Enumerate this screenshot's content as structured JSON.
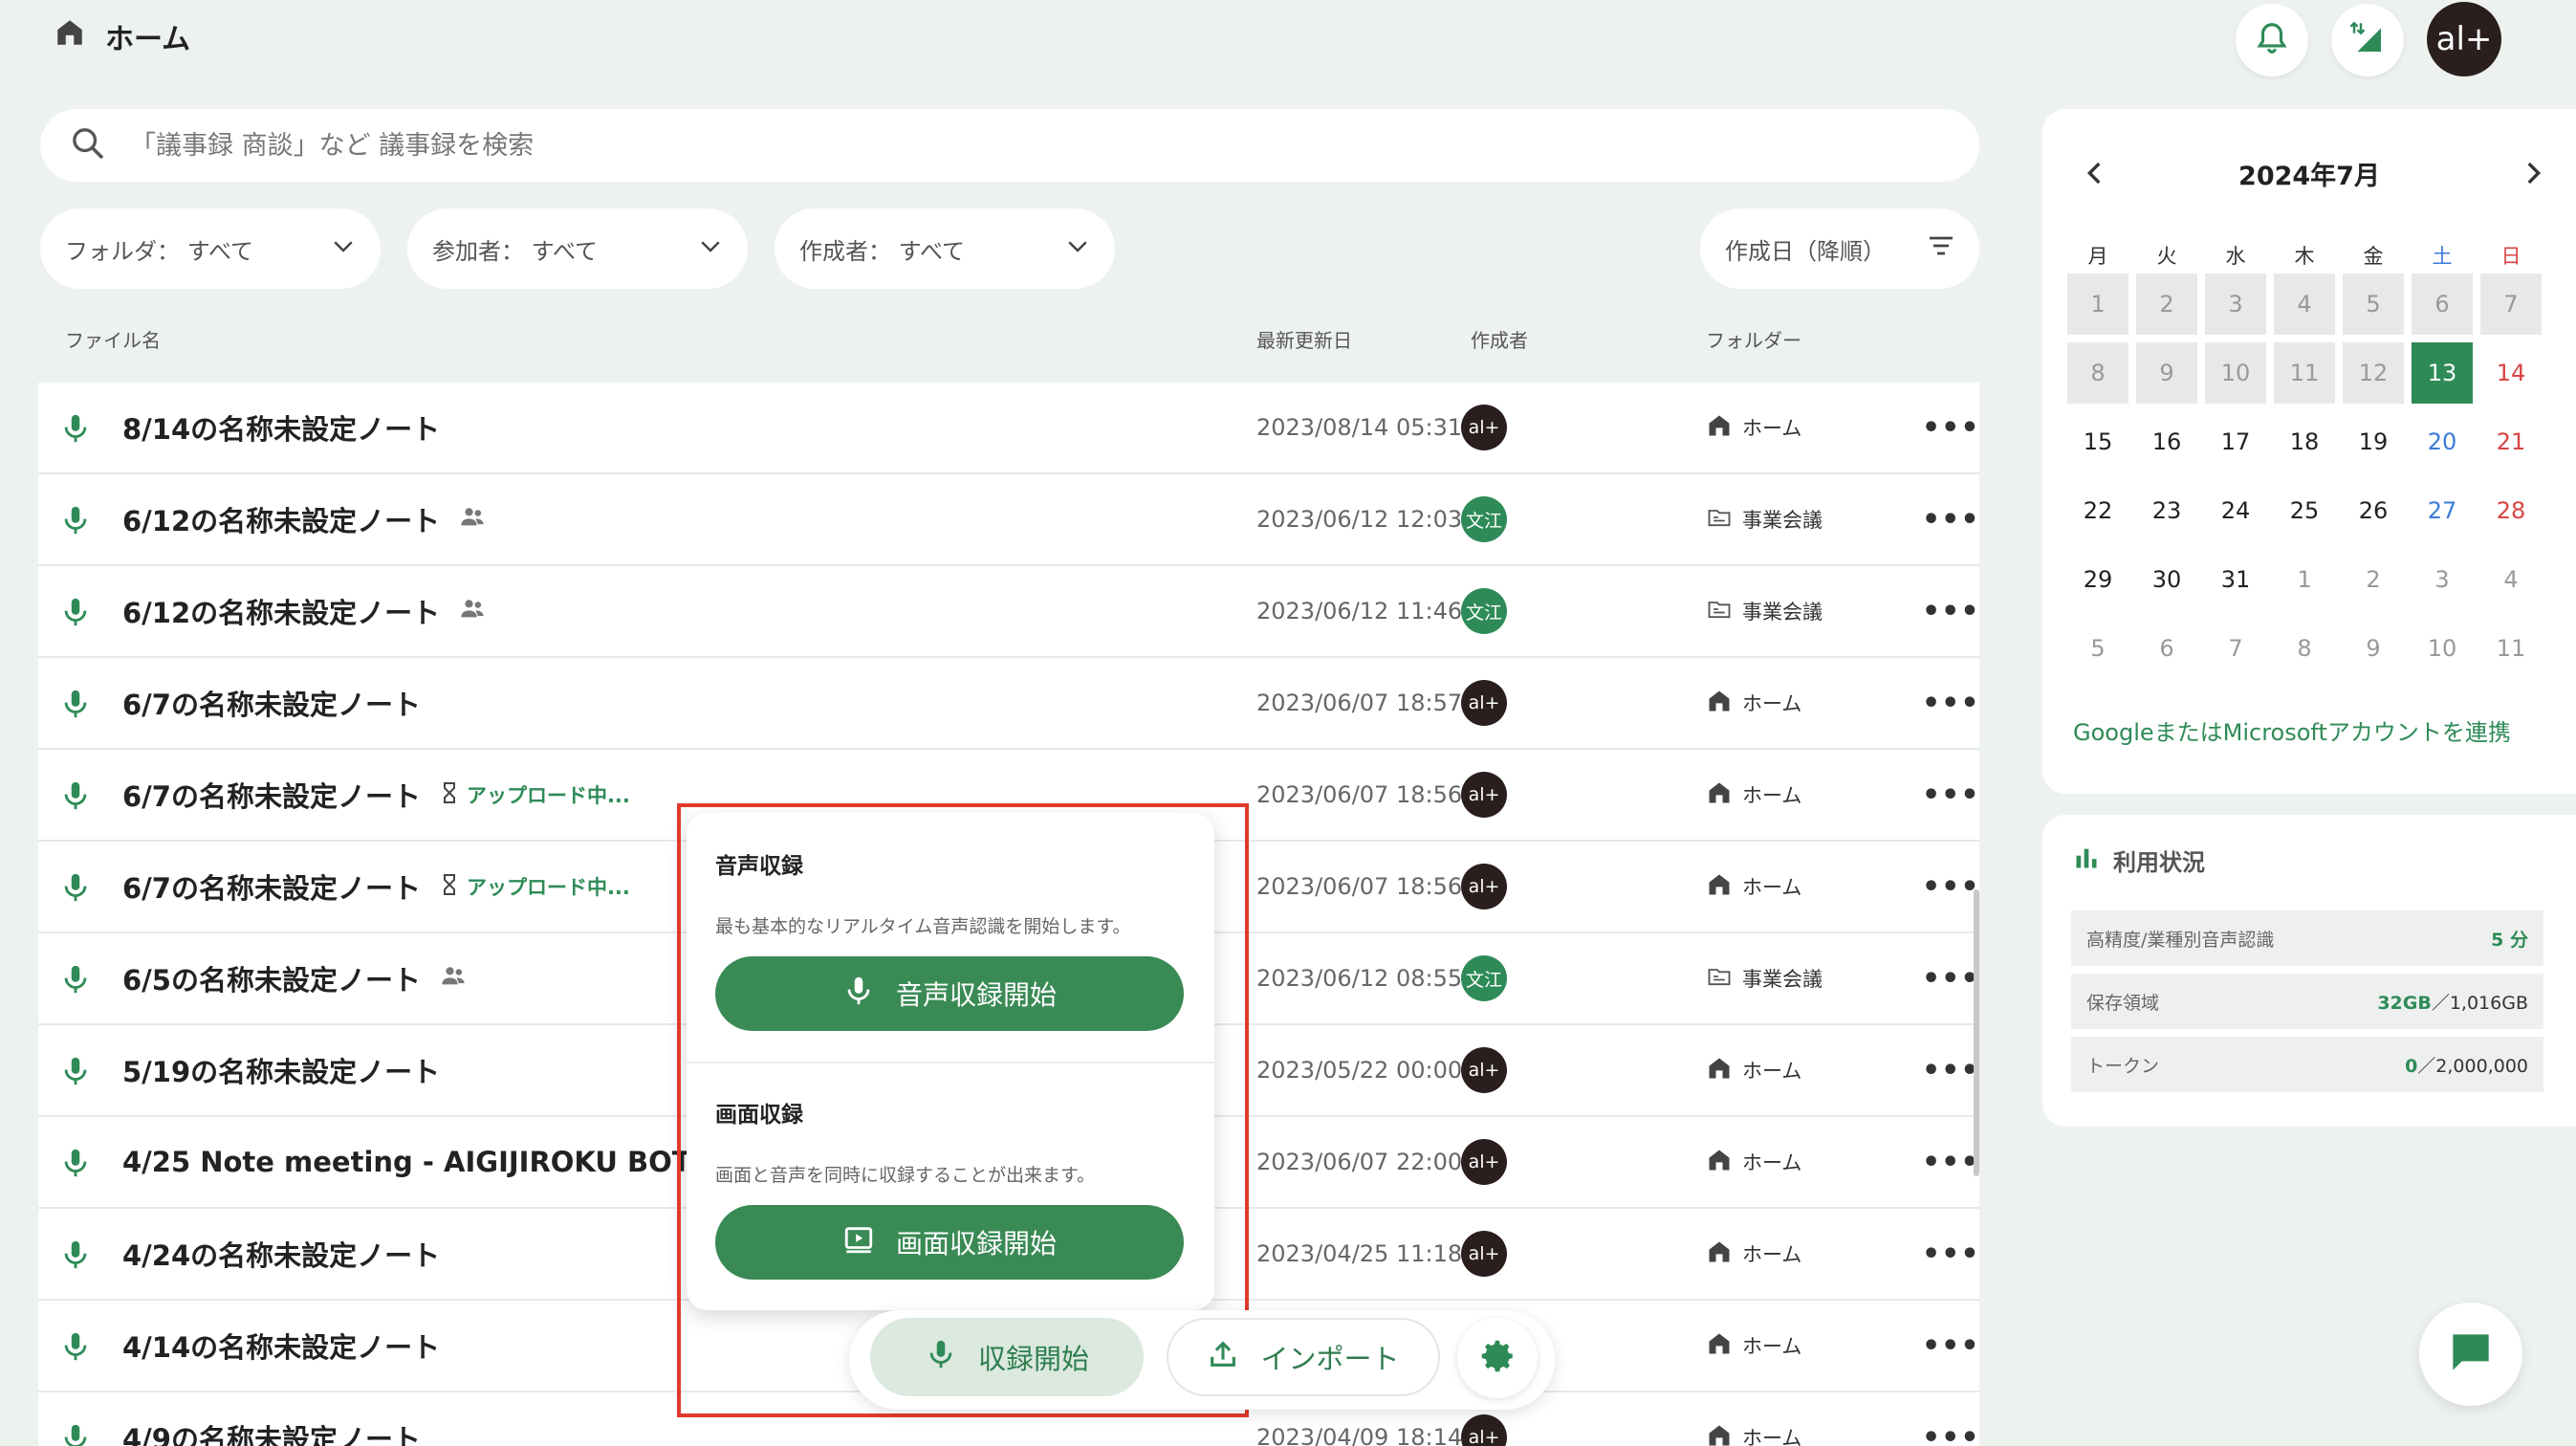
{
  "header": {
    "title": "ホーム",
    "avatar_text": "al+"
  },
  "search": {
    "placeholder": "「議事録 商談」など 議事録を検索",
    "value": ""
  },
  "filters": {
    "folder": "フォルダ： すべて",
    "participant": "参加者： すべて",
    "author": "作成者： すべて",
    "sort": "作成日（降順）"
  },
  "table": {
    "headers": {
      "filename": "ファイル名",
      "updated": "最新更新日",
      "author": "作成者",
      "folder": "フォルダー"
    },
    "rows": [
      {
        "title": "8/14の名称未設定ノート",
        "shared": false,
        "uploading": false,
        "date": "2023/08/14 05:31",
        "author": "al+",
        "author_style": "dark",
        "folder": "ホーム",
        "folder_type": "home"
      },
      {
        "title": "6/12の名称未設定ノート",
        "shared": true,
        "uploading": false,
        "date": "2023/06/12 12:03",
        "author": "文江",
        "author_style": "green",
        "folder": "事業会議",
        "folder_type": "folder"
      },
      {
        "title": "6/12の名称未設定ノート",
        "shared": true,
        "uploading": false,
        "date": "2023/06/12 11:46",
        "author": "文江",
        "author_style": "green",
        "folder": "事業会議",
        "folder_type": "folder"
      },
      {
        "title": "6/7の名称未設定ノート",
        "shared": false,
        "uploading": false,
        "date": "2023/06/07 18:57",
        "author": "al+",
        "author_style": "dark",
        "folder": "ホーム",
        "folder_type": "home"
      },
      {
        "title": "6/7の名称未設定ノート",
        "shared": false,
        "uploading": true,
        "date": "2023/06/07 18:56",
        "author": "al+",
        "author_style": "dark",
        "folder": "ホーム",
        "folder_type": "home"
      },
      {
        "title": "6/7の名称未設定ノート",
        "shared": false,
        "uploading": true,
        "date": "2023/06/07 18:56",
        "author": "al+",
        "author_style": "dark",
        "folder": "ホーム",
        "folder_type": "home"
      },
      {
        "title": "6/5の名称未設定ノート",
        "shared": true,
        "uploading": false,
        "date": "2023/06/12 08:55",
        "author": "文江",
        "author_style": "green",
        "folder": "事業会議",
        "folder_type": "folder"
      },
      {
        "title": "5/19の名称未設定ノート",
        "shared": false,
        "uploading": false,
        "date": "2023/05/22 00:00",
        "author": "al+",
        "author_style": "dark",
        "folder": "ホーム",
        "folder_type": "home"
      },
      {
        "title": "4/25 Note meeting - AIGIJIROKU BOT",
        "shared": false,
        "uploading": false,
        "date": "2023/06/07 22:00",
        "author": "al+",
        "author_style": "dark",
        "folder": "ホーム",
        "folder_type": "home"
      },
      {
        "title": "4/24の名称未設定ノート",
        "shared": false,
        "uploading": false,
        "date": "2023/04/25 11:18",
        "author": "al+",
        "author_style": "dark",
        "folder": "ホーム",
        "folder_type": "home"
      },
      {
        "title": "4/14の名称未設定ノート",
        "shared": false,
        "uploading": false,
        "date": "",
        "author": "",
        "author_style": "none",
        "folder": "ホーム",
        "folder_type": "home"
      },
      {
        "title": "4/9の名称未設定ノート",
        "shared": false,
        "uploading": false,
        "date": "2023/04/09 18:14",
        "author": "al+",
        "author_style": "dark",
        "folder": "ホーム",
        "folder_type": "home"
      }
    ],
    "upload_status": "アップロード中...",
    "more_label": "•••"
  },
  "calendar": {
    "title": "2024年7月",
    "weekdays": [
      "月",
      "火",
      "水",
      "木",
      "金",
      "土",
      "日"
    ],
    "weeks": [
      [
        [
          "1",
          "past"
        ],
        [
          "2",
          "past"
        ],
        [
          "3",
          "past"
        ],
        [
          "4",
          "past"
        ],
        [
          "5",
          "past"
        ],
        [
          "6",
          "past"
        ],
        [
          "7",
          "past"
        ]
      ],
      [
        [
          "8",
          "past"
        ],
        [
          "9",
          "past"
        ],
        [
          "10",
          "past"
        ],
        [
          "11",
          "past"
        ],
        [
          "12",
          "past"
        ],
        [
          "13",
          "today"
        ],
        [
          "14",
          "cur"
        ]
      ],
      [
        [
          "15",
          "cur"
        ],
        [
          "16",
          "cur"
        ],
        [
          "17",
          "cur"
        ],
        [
          "18",
          "cur"
        ],
        [
          "19",
          "cur"
        ],
        [
          "20",
          "cur"
        ],
        [
          "21",
          "cur"
        ]
      ],
      [
        [
          "22",
          "cur"
        ],
        [
          "23",
          "cur"
        ],
        [
          "24",
          "cur"
        ],
        [
          "25",
          "cur"
        ],
        [
          "26",
          "cur"
        ],
        [
          "27",
          "cur"
        ],
        [
          "28",
          "cur"
        ]
      ],
      [
        [
          "29",
          "cur"
        ],
        [
          "30",
          "cur"
        ],
        [
          "31",
          "cur"
        ],
        [
          "1",
          "other"
        ],
        [
          "2",
          "other"
        ],
        [
          "3",
          "other"
        ],
        [
          "4",
          "other"
        ]
      ],
      [
        [
          "5",
          "other"
        ],
        [
          "6",
          "other"
        ],
        [
          "7",
          "other"
        ],
        [
          "8",
          "other"
        ],
        [
          "9",
          "other"
        ],
        [
          "10",
          "other"
        ],
        [
          "11",
          "other"
        ]
      ]
    ],
    "link_text": "GoogleまたはMicrosoftアカウントを連携"
  },
  "usage": {
    "title": "利用状況",
    "items": [
      {
        "label": "高精度/業種別音声認識",
        "value": "5",
        "unit": "分"
      },
      {
        "label": "保存領域",
        "value": "32GB",
        "unit": "／1,016GB"
      },
      {
        "label": "トークン",
        "value": "0",
        "unit": "／2,000,000"
      }
    ]
  },
  "popup": {
    "audio_title": "音声収録",
    "audio_desc": "最も基本的なリアルタイム音声認識を開始します。",
    "audio_button": "音声収録開始",
    "screen_title": "画面収録",
    "screen_desc": "画面と音声を同時に収録することが出来ます。",
    "screen_button": "画面収録開始"
  },
  "toolbar": {
    "record_label": "収録開始",
    "import_label": "インポート"
  },
  "colors": {
    "accent": "#2e8b57",
    "button": "#3a8a55",
    "highlight": "#e03a2a",
    "background": "#eef2ef"
  }
}
